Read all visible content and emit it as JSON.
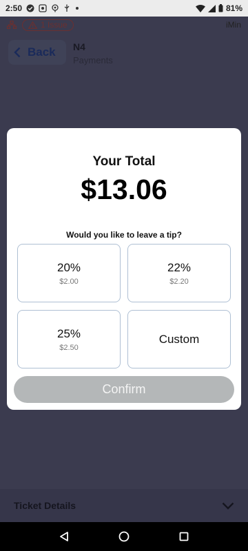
{
  "status_bar": {
    "time": "2:50",
    "battery": "81%",
    "icons": [
      "check-circle-icon",
      "photo-icon",
      "location-icon",
      "usb-icon",
      "dot-icon",
      "wifi-icon",
      "signal-icon",
      "battery-icon"
    ]
  },
  "app": {
    "issue_pill": "1 Issue",
    "brand": "iMin",
    "back_label": "Back",
    "title": "N4",
    "subtitle": "Payments",
    "ticket_details": "Ticket Details"
  },
  "modal": {
    "title": "Your Total",
    "total": "$13.06",
    "tip_question": "Would you like to leave a tip?",
    "tips": [
      {
        "percent": "20%",
        "amount": "$2.00"
      },
      {
        "percent": "22%",
        "amount": "$2.20"
      },
      {
        "percent": "25%",
        "amount": "$2.50"
      }
    ],
    "custom_label": "Custom",
    "confirm_label": "Confirm"
  },
  "colors": {
    "backdrop": "#3b3b4f",
    "modal_bg": "#ffffff",
    "card_border": "#aebfd3",
    "confirm_disabled": "#b4b7b8"
  }
}
